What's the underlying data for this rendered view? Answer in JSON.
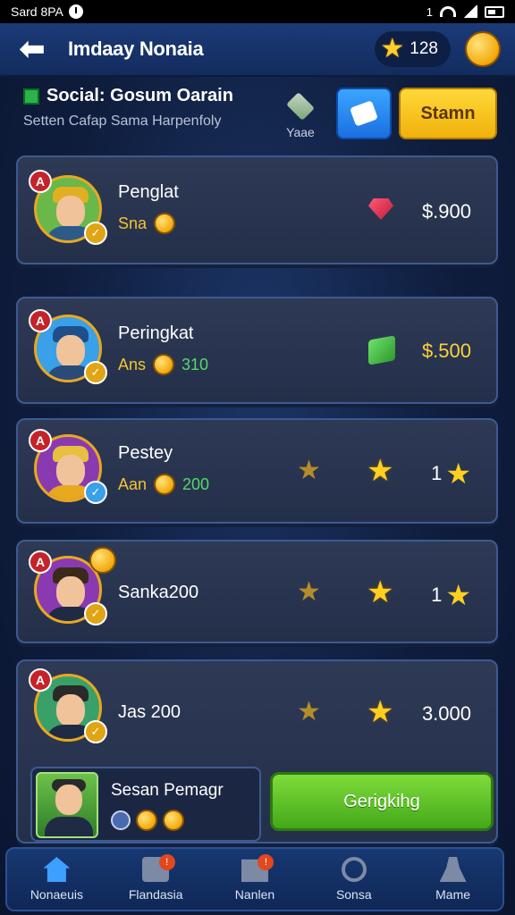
{
  "status_bar": {
    "left_text": "Sard 8PA",
    "right_text": "1"
  },
  "header": {
    "title": "Imdaay Nonaia",
    "star_count": "128"
  },
  "subheader": {
    "title": "Social: Gosum Oarain",
    "subtitle": "Setten Cafap  Sama Harpenfoly",
    "vote_label": "Yaae",
    "yellow_button": "Stamn"
  },
  "rows": [
    {
      "name": "Penglat",
      "sub_label": "Sna",
      "sub_value": "",
      "value": "$.900"
    },
    {
      "name": "Peringkat",
      "sub_label": "Ans",
      "sub_value": "310",
      "value": "$.500"
    },
    {
      "name": "Pestey",
      "sub_label": "Aan",
      "sub_value": "200",
      "value": "1"
    },
    {
      "name": "Sanka200",
      "sub_label": "",
      "sub_value": "",
      "value": "1"
    },
    {
      "name": "Jas 200",
      "sub_label": "",
      "sub_value": "",
      "value": "3.000"
    }
  ],
  "player": {
    "name": "Sesan Pemagr",
    "button": "Gerigkihg"
  },
  "nav": [
    {
      "label": "Nonaeuis",
      "icon": "home-icon"
    },
    {
      "label": "Flandasia",
      "icon": "grid-icon",
      "badge": "!"
    },
    {
      "label": "Nanlen",
      "icon": "mail-icon",
      "badge": "!"
    },
    {
      "label": "Sonsa",
      "icon": "search-icon"
    },
    {
      "label": "Mame",
      "icon": "person-icon"
    }
  ],
  "colors": {
    "accent_yellow": "#ffcf20",
    "button_green": "#5fc22a",
    "panel": "#2a3550",
    "header_blue": "#1b3a78"
  }
}
